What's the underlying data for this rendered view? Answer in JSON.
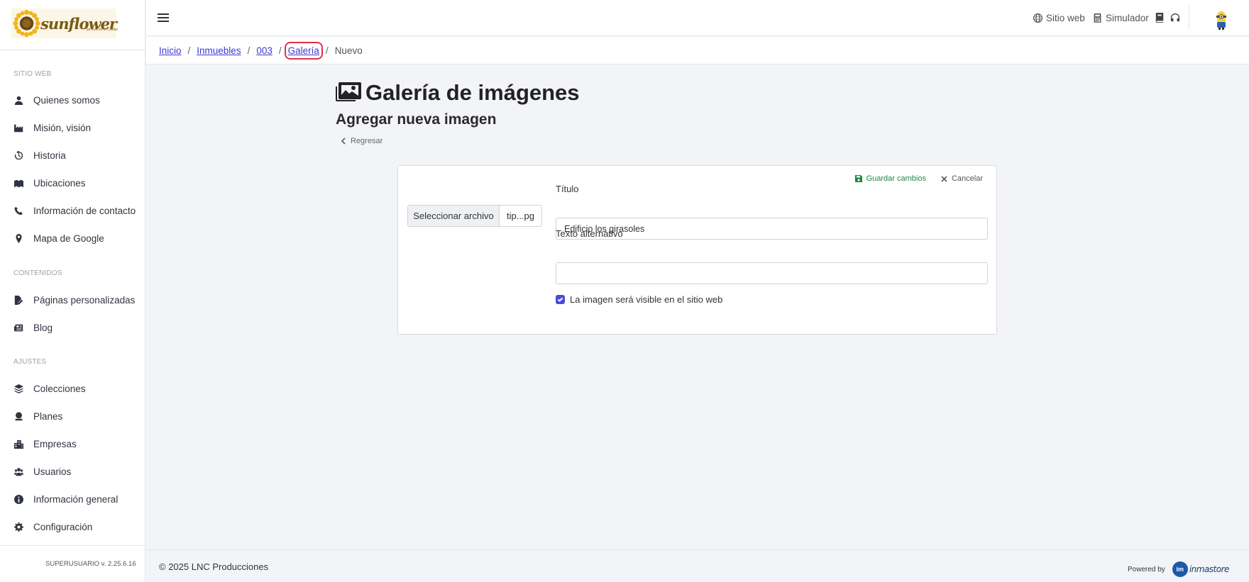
{
  "logo": {
    "text": "sunflower",
    "tagline": "Se vive en el Caribe"
  },
  "sidebar": {
    "sections": [
      {
        "title": "SITIO WEB"
      },
      {
        "title": "CONTENIDOS"
      },
      {
        "title": "AJUSTES"
      }
    ],
    "items": [
      {
        "label": "Quienes somos",
        "icon": "user-icon"
      },
      {
        "label": "Misión, visión",
        "icon": "industry-icon"
      },
      {
        "label": "Historia",
        "icon": "history-icon"
      },
      {
        "label": "Ubicaciones",
        "icon": "map-location-icon"
      },
      {
        "label": "Información de contacto",
        "icon": "phone-icon"
      },
      {
        "label": "Mapa de Google",
        "icon": "map-pin-icon"
      },
      {
        "label": "Páginas personalizadas",
        "icon": "file-edit-icon"
      },
      {
        "label": "Blog",
        "icon": "newspaper-icon"
      },
      {
        "label": "Colecciones",
        "icon": "layers-icon"
      },
      {
        "label": "Planes",
        "icon": "plan-icon"
      },
      {
        "label": "Empresas",
        "icon": "building-icon"
      },
      {
        "label": "Usuarios",
        "icon": "users-icon"
      },
      {
        "label": "Información general",
        "icon": "info-icon"
      },
      {
        "label": "Configuración",
        "icon": "gear-icon"
      }
    ],
    "version": "SUPERUSUARIO v. 2.25.6.16"
  },
  "topbar": {
    "site_link": "Sitio web",
    "simulator_link": "Simulador"
  },
  "breadcrumb": {
    "items": [
      "Inicio",
      "Inmuebles",
      "003",
      "Galería"
    ],
    "current": "Nuevo"
  },
  "page": {
    "title": "Galería de imágenes",
    "subtitle": "Agregar nueva imagen",
    "back_label": "Regresar"
  },
  "form": {
    "save_label": "Guardar cambios",
    "cancel_label": "Cancelar",
    "file_button": "Seleccionar archivo",
    "file_name": "tip...pg",
    "title_label": "Título",
    "title_value": "Edificio los girasoles",
    "alt_label": "Texto alternativo",
    "alt_value": "",
    "visible_label": "La imagen será visible en el sitio web",
    "visible_checked": true
  },
  "footer": {
    "copyright": "© 2025 LNC Producciones",
    "powered_by": "Powered by",
    "brand": "inmastore"
  },
  "colors": {
    "accent": "#3b3bd1",
    "save": "#1c8a3c",
    "highlight": "#e0314d",
    "checkbox": "#4a4ae0"
  }
}
